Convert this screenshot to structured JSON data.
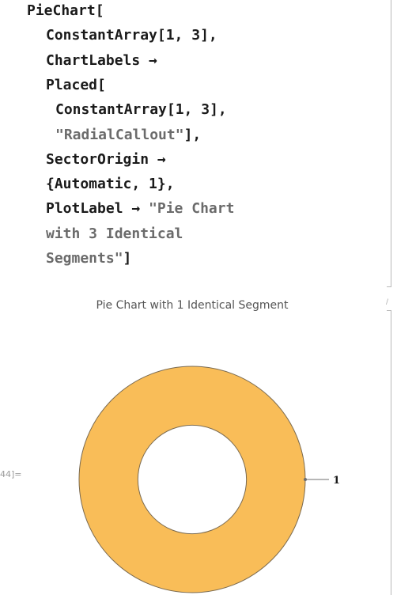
{
  "input": {
    "lines": [
      {
        "indent": 34,
        "parts": [
          {
            "text": "PieChart[",
            "kind": "code"
          }
        ]
      },
      {
        "indent": 58,
        "parts": [
          {
            "text": "ConstantArray[1, 3],",
            "kind": "code"
          }
        ]
      },
      {
        "indent": 58,
        "parts": [
          {
            "text": "ChartLabels →",
            "kind": "code"
          }
        ]
      },
      {
        "indent": 58,
        "parts": [
          {
            "text": "Placed[",
            "kind": "code"
          }
        ]
      },
      {
        "indent": 70,
        "parts": [
          {
            "text": "ConstantArray[1, 3],",
            "kind": "code"
          }
        ]
      },
      {
        "indent": 70,
        "parts": [
          {
            "text": "\"RadialCallout\"",
            "kind": "str"
          },
          {
            "text": "],",
            "kind": "code"
          }
        ]
      },
      {
        "indent": 58,
        "parts": [
          {
            "text": "SectorOrigin →",
            "kind": "code"
          }
        ]
      },
      {
        "indent": 58,
        "parts": [
          {
            "text": "{Automatic, 1},",
            "kind": "code"
          }
        ]
      },
      {
        "indent": 58,
        "parts": [
          {
            "text": "PlotLabel → ",
            "kind": "code"
          },
          {
            "text": "\"Pie Chart",
            "kind": "str"
          }
        ]
      },
      {
        "indent": 58,
        "parts": [
          {
            "text": "with 3 Identical",
            "kind": "str"
          }
        ]
      },
      {
        "indent": 58,
        "parts": [
          {
            "text": "Segments\"",
            "kind": "str"
          },
          {
            "text": "]",
            "kind": "code"
          }
        ]
      }
    ]
  },
  "output": {
    "cell_label": "44]=",
    "plot_label": "Pie Chart with 1 Identical Segment",
    "callout_label": "1",
    "sector_color": "#f9bd58",
    "edge_color": "#7a6a50"
  },
  "chart_data": {
    "type": "pie",
    "title": "Pie Chart with 1 Identical Segment",
    "categories": [
      "1"
    ],
    "values": [
      1
    ],
    "inner_radius_ratio": 0.48,
    "label_placement": "radial-callout-right"
  }
}
